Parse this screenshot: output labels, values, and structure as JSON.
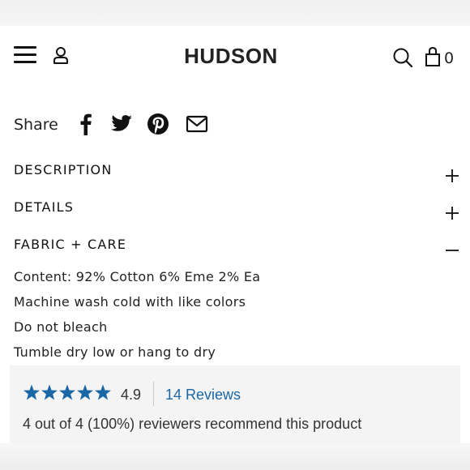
{
  "header": {
    "brand": "HUDSON",
    "cart_count": "0"
  },
  "share": {
    "label": "Share",
    "icons": [
      "facebook-icon",
      "twitter-icon",
      "pinterest-icon",
      "email-icon"
    ]
  },
  "accordion": [
    {
      "title": "DESCRIPTION",
      "state": "collapsed"
    },
    {
      "title": "DETAILS",
      "state": "collapsed"
    },
    {
      "title": "FABRIC + CARE",
      "state": "expanded"
    }
  ],
  "fabric_care": {
    "lines": [
      "Content: 92% Cotton 6% Eme 2% Ea",
      "Machine wash cold with like colors",
      "Do not bleach",
      "Tumble dry low or hang to dry"
    ]
  },
  "reviews": {
    "rating": "4.9",
    "stars_filled": 5,
    "star_color": "#1a67a6",
    "count_label": "14 Reviews",
    "recommend_text": "4 out of 4 (100%) reviewers recommend this product"
  }
}
